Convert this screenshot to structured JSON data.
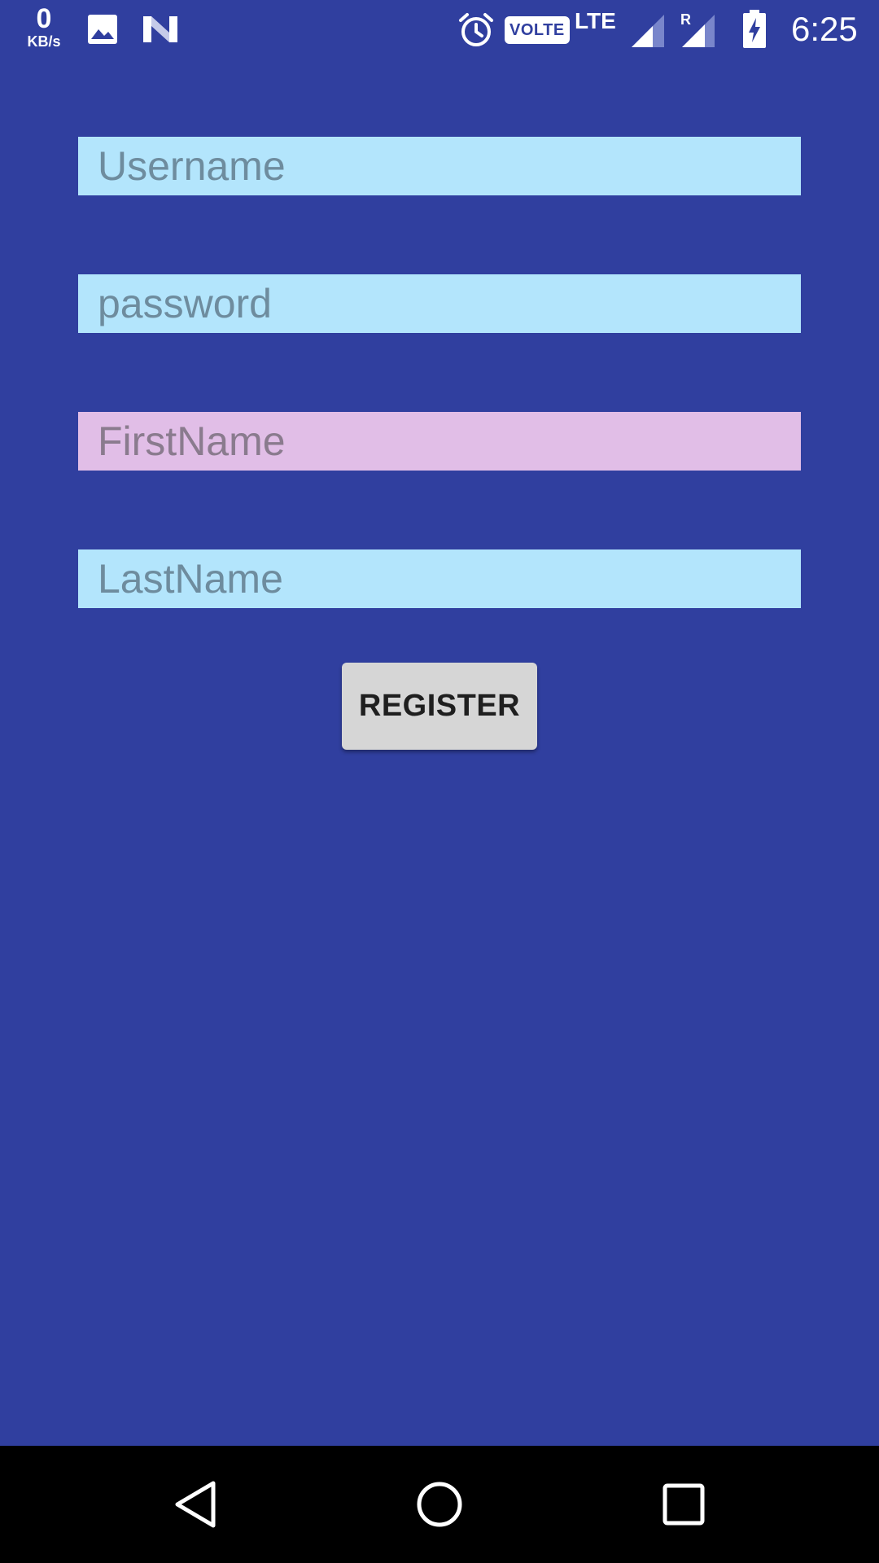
{
  "status_bar": {
    "net_speed_value": "0",
    "net_speed_unit": "KB/s",
    "volte_label": "VOLTE",
    "lte_label": "LTE",
    "roaming_label": "R",
    "time": "6:25",
    "icons": [
      "gallery-icon",
      "n-icon",
      "alarm-icon",
      "signal-icon",
      "signal-roaming-icon",
      "battery-charging-icon"
    ]
  },
  "form": {
    "username_placeholder": "Username",
    "password_placeholder": "password",
    "firstname_placeholder": "FirstName",
    "lastname_placeholder": "LastName",
    "register_label": "REGISTER"
  },
  "navigation": {
    "icons": [
      "back-icon",
      "home-icon",
      "recents-icon"
    ]
  },
  "colors": {
    "background": "#303F9F",
    "field_blue": "#B3E5FC",
    "field_pink": "#E1BEE7",
    "button": "#D6D6D6",
    "nav_bar": "#000000"
  }
}
